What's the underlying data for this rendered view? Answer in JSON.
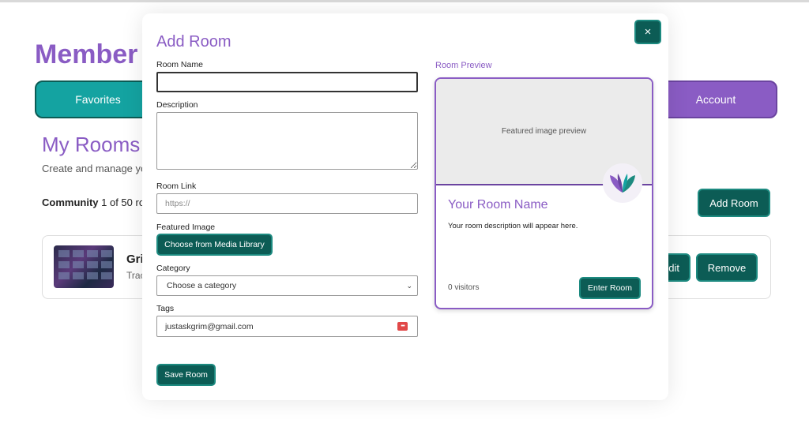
{
  "background": {
    "title": "Member",
    "tabs": {
      "favorites": "Favorites",
      "account": "Account"
    },
    "my_rooms_title": "My Rooms",
    "my_rooms_subtitle": "Create and manage yo",
    "community_label": "Community",
    "community_count": "1 of 50 ro",
    "add_room_button": "Add Room",
    "room_card": {
      "name": "Gri",
      "subtitle": "Trac",
      "edit_label": "dit",
      "remove_label": "Remove"
    }
  },
  "modal": {
    "title": "Add Room",
    "close_label": "×",
    "fields": {
      "room_name": {
        "label": "Room Name",
        "value": ""
      },
      "description": {
        "label": "Description",
        "value": ""
      },
      "room_link": {
        "label": "Room Link",
        "placeholder": "https://"
      },
      "featured_image": {
        "label": "Featured Image",
        "button": "Choose from Media Library"
      },
      "category": {
        "label": "Category",
        "selected": "Choose a category"
      },
      "tags": {
        "label": "Tags",
        "value": "justaskgrim@gmail.com"
      }
    },
    "save_button": "Save Room"
  },
  "preview": {
    "label": "Room Preview",
    "image_placeholder": "Featured image preview",
    "room_name": "Your Room Name",
    "room_description": "Your room description will appear here.",
    "visitors": "0 visitors",
    "enter_button": "Enter Room"
  },
  "colors": {
    "accent_purple": "#8a5cc4",
    "button_teal": "#0c5c55",
    "teal_tab": "#14a3a1"
  }
}
